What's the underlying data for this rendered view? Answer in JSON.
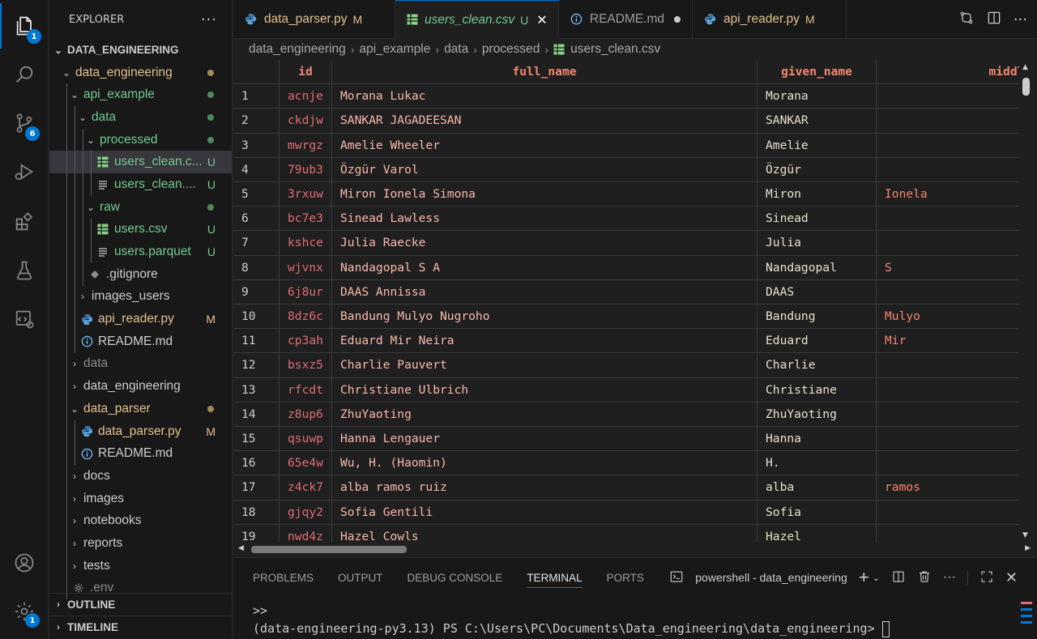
{
  "activity_bar": {
    "explorer_badge": "1",
    "scm_badge": "6",
    "settings_badge": "1"
  },
  "sidebar": {
    "title": "EXPLORER",
    "more": "···",
    "root_label": "DATA_ENGINEERING",
    "items": [
      {
        "label": "data_engineering",
        "status": "",
        "depth": 1,
        "open": true,
        "kind": "folder",
        "color": "mod",
        "dot": "#a5855a"
      },
      {
        "label": "api_example",
        "status": "",
        "depth": 2,
        "open": true,
        "kind": "folder",
        "color": "green",
        "dot": "#4f8a5d"
      },
      {
        "label": "data",
        "status": "",
        "depth": 3,
        "open": true,
        "kind": "folder",
        "color": "green",
        "dot": "#4f8a5d"
      },
      {
        "label": "processed",
        "status": "",
        "depth": 4,
        "open": true,
        "kind": "folder",
        "color": "green",
        "dot": "#4f8a5d"
      },
      {
        "label": "users_clean.c...",
        "status": "U",
        "depth": 5,
        "kind": "csv",
        "color": "green",
        "selected": true
      },
      {
        "label": "users_clean....",
        "status": "U",
        "depth": 5,
        "kind": "lines",
        "color": "green"
      },
      {
        "label": "raw",
        "status": "",
        "depth": 4,
        "open": true,
        "kind": "folder",
        "color": "green",
        "dot": "#4f8a5d"
      },
      {
        "label": "users.csv",
        "status": "U",
        "depth": 5,
        "kind": "csv",
        "color": "green"
      },
      {
        "label": "users.parquet",
        "status": "U",
        "depth": 5,
        "kind": "lines",
        "color": "green"
      },
      {
        "label": ".gitignore",
        "status": "",
        "depth": 4,
        "kind": "git",
        "color": "plain"
      },
      {
        "label": "images_users",
        "status": "",
        "depth": 3,
        "open": false,
        "kind": "folder",
        "color": "plain"
      },
      {
        "label": "api_reader.py",
        "status": "M",
        "depth": 3,
        "kind": "py",
        "color": "mod"
      },
      {
        "label": "README.md",
        "status": "",
        "depth": 3,
        "kind": "info",
        "color": "plain"
      },
      {
        "label": "data",
        "status": "",
        "depth": 2,
        "open": false,
        "kind": "folder",
        "color": "ign"
      },
      {
        "label": "data_engineering",
        "status": "",
        "depth": 2,
        "open": false,
        "kind": "folder",
        "color": "plain"
      },
      {
        "label": "data_parser",
        "status": "",
        "depth": 2,
        "open": true,
        "kind": "folder",
        "color": "mod",
        "dot": "#a5855a"
      },
      {
        "label": "data_parser.py",
        "status": "M",
        "depth": 3,
        "kind": "py",
        "color": "mod"
      },
      {
        "label": "README.md",
        "status": "",
        "depth": 3,
        "kind": "info",
        "color": "plain"
      },
      {
        "label": "docs",
        "status": "",
        "depth": 2,
        "open": false,
        "kind": "folder",
        "color": "plain"
      },
      {
        "label": "images",
        "status": "",
        "depth": 2,
        "open": false,
        "kind": "folder",
        "color": "plain"
      },
      {
        "label": "notebooks",
        "status": "",
        "depth": 2,
        "open": false,
        "kind": "folder",
        "color": "plain"
      },
      {
        "label": "reports",
        "status": "",
        "depth": 2,
        "open": false,
        "kind": "folder",
        "color": "plain"
      },
      {
        "label": "tests",
        "status": "",
        "depth": 2,
        "open": false,
        "kind": "folder",
        "color": "plain"
      },
      {
        "label": ".env",
        "status": "",
        "depth": 2,
        "kind": "gear",
        "color": "ign"
      }
    ],
    "outline_label": "OUTLINE",
    "timeline_label": "TIMELINE"
  },
  "tabs": [
    {
      "label": "data_parser.py",
      "status": "M",
      "kind": "py",
      "active": false
    },
    {
      "label": "users_clean.csv",
      "status": "U",
      "kind": "csv",
      "active": true
    },
    {
      "label": "README.md",
      "status": "",
      "kind": "info",
      "active": false,
      "dirty": true
    },
    {
      "label": "api_reader.py",
      "status": "M",
      "kind": "py",
      "active": false
    }
  ],
  "breadcrumb": [
    "data_engineering",
    "api_example",
    "data",
    "processed",
    "users_clean.csv"
  ],
  "grid": {
    "columns": [
      "",
      "id",
      "full_name",
      "given_name",
      "middle_"
    ],
    "rows": [
      [
        "1",
        "acnje",
        "Morana Lukac",
        "Morana",
        ""
      ],
      [
        "2",
        "ckdjw",
        "SANKAR JAGADEESAN",
        "SANKAR",
        ""
      ],
      [
        "3",
        "mwrgz",
        "Amelie Wheeler",
        "Amelie",
        ""
      ],
      [
        "4",
        "79ub3",
        "Özgür Varol",
        "Özgür",
        ""
      ],
      [
        "5",
        "3rxuw",
        "Miron Ionela Simona",
        "Miron",
        "Ionela"
      ],
      [
        "6",
        "bc7e3",
        "Sinead Lawless",
        "Sinead",
        ""
      ],
      [
        "7",
        "kshce",
        "Julia Raecke",
        "Julia",
        ""
      ],
      [
        "8",
        "wjvnx",
        "Nandagopal S A",
        "Nandagopal",
        "S"
      ],
      [
        "9",
        "6j8ur",
        "DAAS Annissa",
        "DAAS",
        ""
      ],
      [
        "10",
        "8dz6c",
        "Bandung Mulyo Nugroho",
        "Bandung",
        "Mulyo"
      ],
      [
        "11",
        "cp3ah",
        "Eduard Mir Neira",
        "Eduard",
        "Mir"
      ],
      [
        "12",
        "bsxz5",
        "Charlie Pauvert",
        "Charlie",
        ""
      ],
      [
        "13",
        "rfcdt",
        "Christiane Ulbrich",
        "Christiane",
        ""
      ],
      [
        "14",
        "z8up6",
        "ZhuYaoting",
        "ZhuYaoting",
        ""
      ],
      [
        "15",
        "qsuwp",
        "Hanna Lengauer",
        "Hanna",
        ""
      ],
      [
        "16",
        "65e4w",
        "Wu, H. (Haomin)",
        "H.",
        ""
      ],
      [
        "17",
        "z4ck7",
        "alba ramos ruiz",
        "alba",
        "ramos"
      ],
      [
        "18",
        "gjqy2",
        "Sofia Gentili",
        "Sofia",
        ""
      ],
      [
        "19",
        "nwd4z",
        "Hazel Cowls",
        "Hazel",
        ""
      ]
    ]
  },
  "panel": {
    "tabs": [
      "PROBLEMS",
      "OUTPUT",
      "DEBUG CONSOLE",
      "TERMINAL",
      "PORTS"
    ],
    "active_tab": "TERMINAL",
    "terminal_name": "powershell - data_engineering",
    "lines": [
      ">>",
      "(data-engineering-py3.13) PS C:\\Users\\PC\\Documents\\Data_engineering\\data_engineering> "
    ]
  },
  "colors": {
    "accent": "#0078d4",
    "untracked": "#73c991",
    "modified": "#e2c08d",
    "csv_header": "#f48771"
  }
}
